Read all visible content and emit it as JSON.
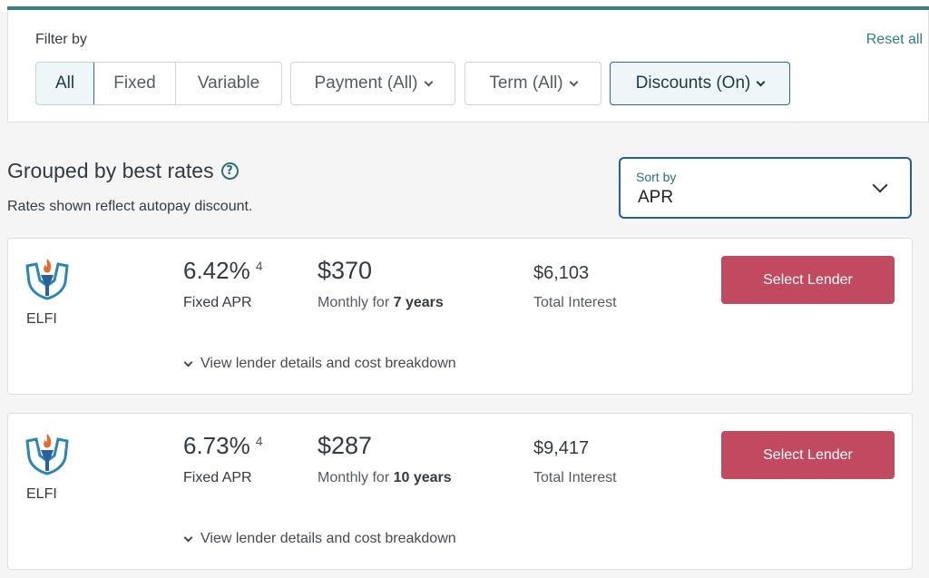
{
  "filters": {
    "label": "Filter by",
    "reset_label": "Reset all",
    "segments": [
      {
        "label": "All",
        "active": true
      },
      {
        "label": "Fixed",
        "active": false
      },
      {
        "label": "Variable",
        "active": false
      }
    ],
    "dropdowns": {
      "payment": "Payment (All)",
      "term": "Term (All)",
      "discounts": "Discounts (On)"
    }
  },
  "results": {
    "title": "Grouped by best rates",
    "subtitle": "Rates shown reflect autopay discount.",
    "sort": {
      "label": "Sort by",
      "value": "APR"
    }
  },
  "lenders": [
    {
      "name": "ELFI",
      "rate": "6.42%",
      "footnote": "4",
      "rate_type": "Fixed APR",
      "monthly": "$370",
      "monthly_prefix": "Monthly for",
      "term": "7 years",
      "total_interest": "$6,103",
      "interest_label": "Total Interest",
      "button": "Select Lender",
      "details": "View lender details and cost breakdown"
    },
    {
      "name": "ELFI",
      "rate": "6.73%",
      "footnote": "4",
      "rate_type": "Fixed APR",
      "monthly": "$287",
      "monthly_prefix": "Monthly for",
      "term": "10 years",
      "total_interest": "$9,417",
      "interest_label": "Total Interest",
      "button": "Select Lender",
      "details": "View lender details and cost breakdown"
    }
  ],
  "colors": {
    "accent": "#2d6e7a",
    "button": "#c24a60",
    "sort_border": "#1f5fa3"
  }
}
